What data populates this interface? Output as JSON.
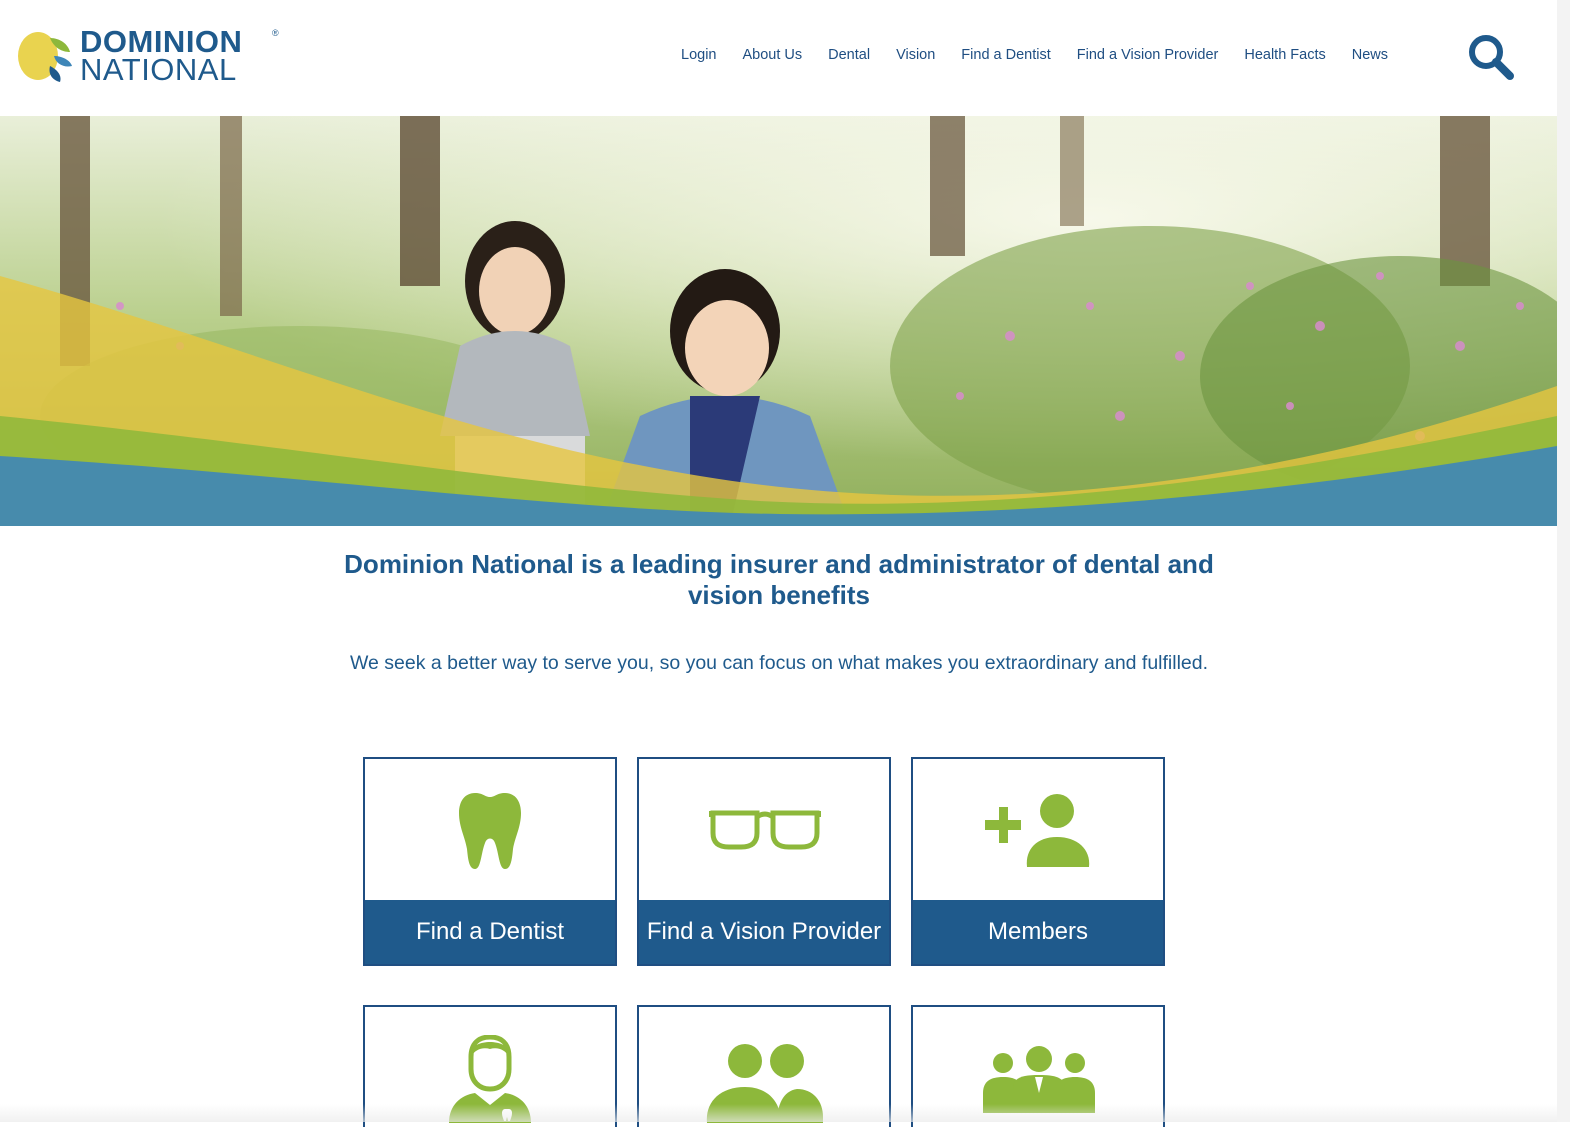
{
  "brand": {
    "name_line1": "DOMINION",
    "name_line2": "NATIONAL",
    "registered_mark": "®",
    "colors": {
      "primary": "#1f5a8c",
      "accent_green": "#8db83b",
      "accent_yellow": "#e9cf4e",
      "accent_blue": "#3e86b8"
    }
  },
  "nav": {
    "items": [
      {
        "label": "Login"
      },
      {
        "label": "About Us"
      },
      {
        "label": "Dental"
      },
      {
        "label": "Vision"
      },
      {
        "label": "Find a Dentist"
      },
      {
        "label": "Find a Vision Provider"
      },
      {
        "label": "Health Facts"
      },
      {
        "label": "News"
      }
    ],
    "search_icon": "search-icon"
  },
  "hero": {
    "image": "children-running-in-forest-photo"
  },
  "intro": {
    "headline": "Dominion National is a leading insurer and administrator of dental and vision benefits",
    "tagline": "We seek a better way to serve you, so you can focus on what makes you extraordinary and fulfilled."
  },
  "cards": [
    {
      "label": "Find a Dentist",
      "icon": "tooth-icon"
    },
    {
      "label": "Find a Vision Provider",
      "icon": "glasses-icon"
    },
    {
      "label": "Members",
      "icon": "add-member-icon"
    },
    {
      "label": "",
      "icon": "dentist-provider-icon"
    },
    {
      "label": "",
      "icon": "group-icon"
    },
    {
      "label": "",
      "icon": "business-team-icon"
    }
  ]
}
